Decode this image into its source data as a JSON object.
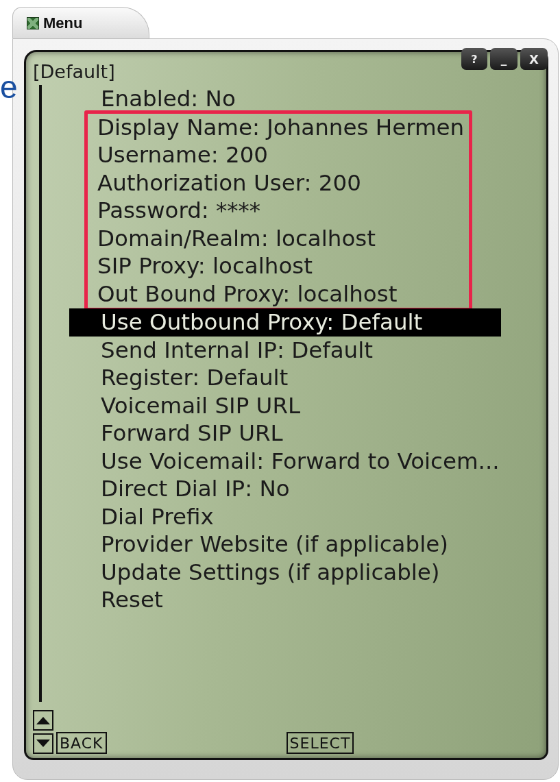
{
  "background_text": "e",
  "window": {
    "title": "Menu",
    "buttons": [
      {
        "kind": "help",
        "label": "?"
      },
      {
        "kind": "minimize",
        "label": "_"
      },
      {
        "kind": "close",
        "label": "X"
      }
    ]
  },
  "menu": {
    "heading": "[Default]",
    "items": [
      {
        "label": "Enabled: No",
        "selected": false,
        "boxed": false
      },
      {
        "label": "Display Name: Johannes Hermen",
        "selected": false,
        "boxed": true
      },
      {
        "label": "Username: 200",
        "selected": false,
        "boxed": true
      },
      {
        "label": "Authorization User: 200",
        "selected": false,
        "boxed": true
      },
      {
        "label": "Password: ****",
        "selected": false,
        "boxed": true
      },
      {
        "label": "Domain/Realm: localhost",
        "selected": false,
        "boxed": true
      },
      {
        "label": "SIP Proxy: localhost",
        "selected": false,
        "boxed": true
      },
      {
        "label": "Out Bound Proxy: localhost",
        "selected": false,
        "boxed": true
      },
      {
        "label": "Use Outbound Proxy: Default",
        "selected": true,
        "boxed": false
      },
      {
        "label": "Send Internal IP: Default",
        "selected": false,
        "boxed": false
      },
      {
        "label": "Register: Default",
        "selected": false,
        "boxed": false
      },
      {
        "label": "Voicemail SIP URL",
        "selected": false,
        "boxed": false
      },
      {
        "label": "Forward SIP URL",
        "selected": false,
        "boxed": false
      },
      {
        "label": "Use Voicemail: Forward to Voicem...",
        "selected": false,
        "boxed": false
      },
      {
        "label": "Direct Dial IP: No",
        "selected": false,
        "boxed": false
      },
      {
        "label": "Dial Prefix",
        "selected": false,
        "boxed": false
      },
      {
        "label": "Provider Website (if applicable)",
        "selected": false,
        "boxed": false
      },
      {
        "label": "Update Settings (if applicable)",
        "selected": false,
        "boxed": false
      },
      {
        "label": "Reset",
        "selected": false,
        "boxed": false
      }
    ]
  },
  "softkeys": {
    "left": "BACK",
    "center": "SELECT"
  }
}
